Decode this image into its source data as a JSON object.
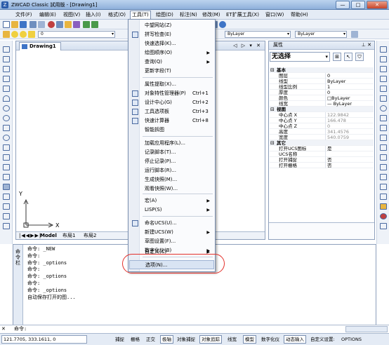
{
  "window": {
    "title": "ZWCAD Classic 試用版 - [Drawing1]",
    "min_label": "—",
    "max_label": "□",
    "close_label": "✕"
  },
  "menubar": {
    "items": [
      "文件(F)",
      "编辑(E)",
      "视图(V)",
      "插入(I)",
      "格式(O)",
      "工具(T)",
      "绘图(D)",
      "标注(N)",
      "修改(M)",
      "ET扩展工具(X)",
      "窗口(W)",
      "帮助(H)"
    ],
    "active_index": 5
  },
  "toolbar": {
    "linetype": "ByLayer",
    "lineweight": "ByLayer",
    "layer": "0"
  },
  "tools_menu": {
    "items": [
      {
        "label": "中望网站(Z)",
        "shortcut": "",
        "arrow": ""
      },
      {
        "label": "拼写检查(E)",
        "shortcut": "",
        "arrow": ""
      },
      {
        "label": "快速选择(K)...",
        "shortcut": "",
        "arrow": ""
      },
      {
        "label": "绘图顺序(O)",
        "shortcut": "",
        "arrow": "▶"
      },
      {
        "label": "查询(Q)",
        "shortcut": "",
        "arrow": "▶"
      },
      {
        "label": "更新字段(T)",
        "shortcut": "",
        "arrow": ""
      },
      {
        "label": "属性提取(X)...",
        "shortcut": "",
        "arrow": ""
      },
      {
        "label": "对象特性管理器(P)",
        "shortcut": "Ctrl+1",
        "arrow": ""
      },
      {
        "label": "设计中心(G)",
        "shortcut": "Ctrl+2",
        "arrow": ""
      },
      {
        "label": "工具选项板",
        "shortcut": "Ctrl+3",
        "arrow": ""
      },
      {
        "label": "快速计算器",
        "shortcut": "Ctrl+8",
        "arrow": ""
      },
      {
        "label": "智能拆图",
        "shortcut": "",
        "arrow": ""
      },
      {
        "label": "加载应用程序(L)...",
        "shortcut": "",
        "arrow": ""
      },
      {
        "label": "记录脚本(T)...",
        "shortcut": "",
        "arrow": ""
      },
      {
        "label": "停止记录(P)...",
        "shortcut": "",
        "arrow": ""
      },
      {
        "label": "运行脚本(R)...",
        "shortcut": "",
        "arrow": ""
      },
      {
        "label": "生成快照(M)...",
        "shortcut": "",
        "arrow": ""
      },
      {
        "label": "观看快照(W)...",
        "shortcut": "",
        "arrow": ""
      },
      {
        "label": "宏(A)",
        "shortcut": "",
        "arrow": "▶"
      },
      {
        "label": "LISP(S)",
        "shortcut": "",
        "arrow": "▶"
      },
      {
        "label": "命名UCS(U)...",
        "shortcut": "",
        "arrow": ""
      },
      {
        "label": "新建UCS(W)",
        "shortcut": "",
        "arrow": "▶"
      },
      {
        "label": "草图设置(F)...",
        "shortcut": "",
        "arrow": ""
      },
      {
        "label": "数字化仪(B)",
        "shortcut": "",
        "arrow": "▶"
      },
      {
        "label": "自定义(C)",
        "shortcut": "",
        "arrow": "▶"
      },
      {
        "label": "选项(N)...",
        "shortcut": "",
        "arrow": ""
      }
    ]
  },
  "drawing": {
    "tab": "Drawing1",
    "controls": "◁ ▷ ▾ ✕",
    "ucs_x": "X",
    "ucs_y": "Y",
    "layout_tabs": [
      "Model",
      "布局1",
      "布局2"
    ]
  },
  "properties": {
    "title": "属性",
    "controls": "⊥ ✕",
    "selection": "无选择",
    "rows": [
      {
        "type": "cat",
        "key": "基本"
      },
      {
        "key": "图层",
        "value": "0"
      },
      {
        "key": "线型",
        "value": "ByLayer"
      },
      {
        "key": "线型比例",
        "value": "1"
      },
      {
        "key": "厚度",
        "value": "0"
      },
      {
        "key": "颜色",
        "value": "□ByLayer"
      },
      {
        "key": "线宽",
        "value": "— ByLayer"
      },
      {
        "type": "cat",
        "key": "视图"
      },
      {
        "key": "中心点 X",
        "value": "122.9842",
        "gray": true
      },
      {
        "key": "中心点 Y",
        "value": "166.478",
        "gray": true
      },
      {
        "key": "中心点 Z",
        "value": "0",
        "gray": true
      },
      {
        "key": "高度",
        "value": "341.4576",
        "gray": true
      },
      {
        "key": "宽度",
        "value": "540.0759",
        "gray": true
      },
      {
        "type": "cat",
        "key": "其它"
      },
      {
        "key": "打开UCS图标",
        "value": "是"
      },
      {
        "key": "UCS名称",
        "value": ""
      },
      {
        "key": "打开捕捉",
        "value": "否"
      },
      {
        "key": "打开栅格",
        "value": "否"
      }
    ]
  },
  "command": {
    "side_label": "命\n令\n栏",
    "lines": [
      "命令: _NEW",
      "命令:",
      "命令: _options",
      "命令:",
      "命令: _options",
      "命令:",
      "命令: _options",
      "自动保存打开的图..."
    ],
    "prompt": "命令:"
  },
  "status": {
    "coords": "121.7705, 333.1611, 0",
    "buttons": [
      {
        "label": "捕捉",
        "on": false
      },
      {
        "label": "栅格",
        "on": false
      },
      {
        "label": "正交",
        "on": false
      },
      {
        "label": "极轴",
        "on": true
      },
      {
        "label": "对象捕捉",
        "on": false
      },
      {
        "label": "对象追踪",
        "on": true
      },
      {
        "label": "线宽",
        "on": false
      },
      {
        "label": "模型",
        "on": true
      },
      {
        "label": "数字化仪",
        "on": false
      },
      {
        "label": "动态输入",
        "on": true
      },
      {
        "label": "自定义设置:",
        "on": false
      },
      {
        "label": "OPTIONS",
        "on": false
      }
    ]
  }
}
